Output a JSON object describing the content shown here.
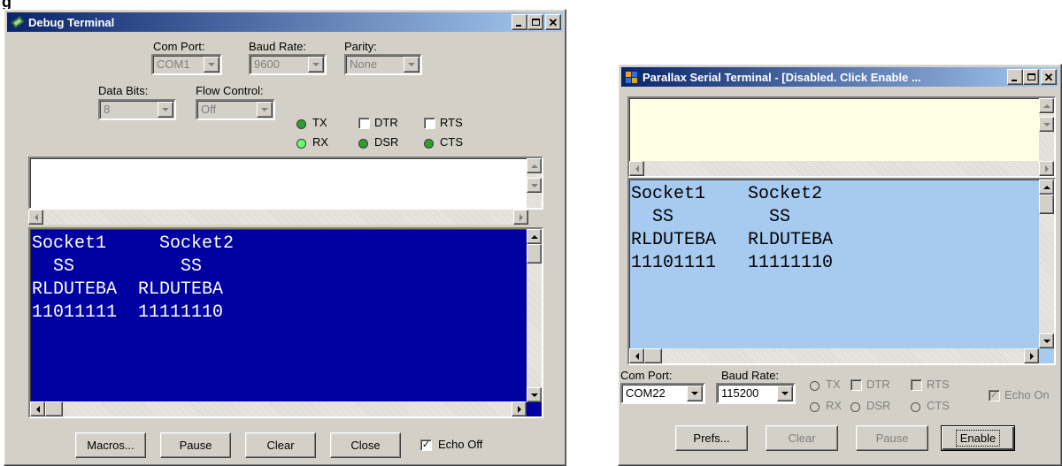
{
  "page": {
    "heading_fragment": "g"
  },
  "debug_terminal": {
    "title": "Debug Terminal",
    "caption_buttons": [
      "_",
      "□",
      "×"
    ],
    "com_port": {
      "label": "Com Port:",
      "value": "COM1"
    },
    "baud_rate": {
      "label": "Baud Rate:",
      "value": "9600"
    },
    "parity": {
      "label": "Parity:",
      "value": "None"
    },
    "data_bits": {
      "label": "Data Bits:",
      "value": "8"
    },
    "flow_control": {
      "label": "Flow Control:",
      "value": "Off"
    },
    "indicators": {
      "tx": "TX",
      "rx": "RX",
      "dtr": "DTR",
      "rts": "RTS",
      "dsr": "DSR",
      "cts": "CTS"
    },
    "colors": {
      "led_on": "#2e9e2e",
      "led_rx": "#66ff66",
      "receive_bg": "#0000a0",
      "receive_text": "#ffffff"
    },
    "receive_lines": [
      "Socket1     Socket2",
      "  SS          SS",
      "RLDUTEBA  RLDUTEBA",
      "11011111  11111110"
    ],
    "buttons": {
      "macros": "Macros...",
      "pause": "Pause",
      "clear": "Clear",
      "close": "Close"
    },
    "echo": {
      "label": "Echo Off",
      "checked": true
    }
  },
  "parallax_terminal": {
    "title": "Parallax Serial Terminal - [Disabled. Click Enable ...",
    "caption_buttons": [
      "_",
      "□",
      "×"
    ],
    "colors": {
      "transmit_bg": "#ffffe6",
      "receive_bg": "#a6caf0",
      "receive_text": "#000000"
    },
    "receive_lines": [
      "Socket1    Socket2",
      "  SS         SS",
      "RLDUTEBA   RLDUTEBA",
      "11101111   11111110"
    ],
    "com_port": {
      "label": "Com Port:",
      "value": "COM22"
    },
    "baud_rate": {
      "label": "Baud Rate:",
      "value": "115200"
    },
    "indicators": {
      "tx": "TX",
      "rx": "RX",
      "dtr": "DTR",
      "rts": "RTS",
      "dsr": "DSR",
      "cts": "CTS"
    },
    "echo": {
      "label": "Echo On",
      "checked": true
    },
    "buttons": {
      "prefs": "Prefs...",
      "clear": "Clear",
      "pause": "Pause",
      "enable": "Enable"
    }
  }
}
